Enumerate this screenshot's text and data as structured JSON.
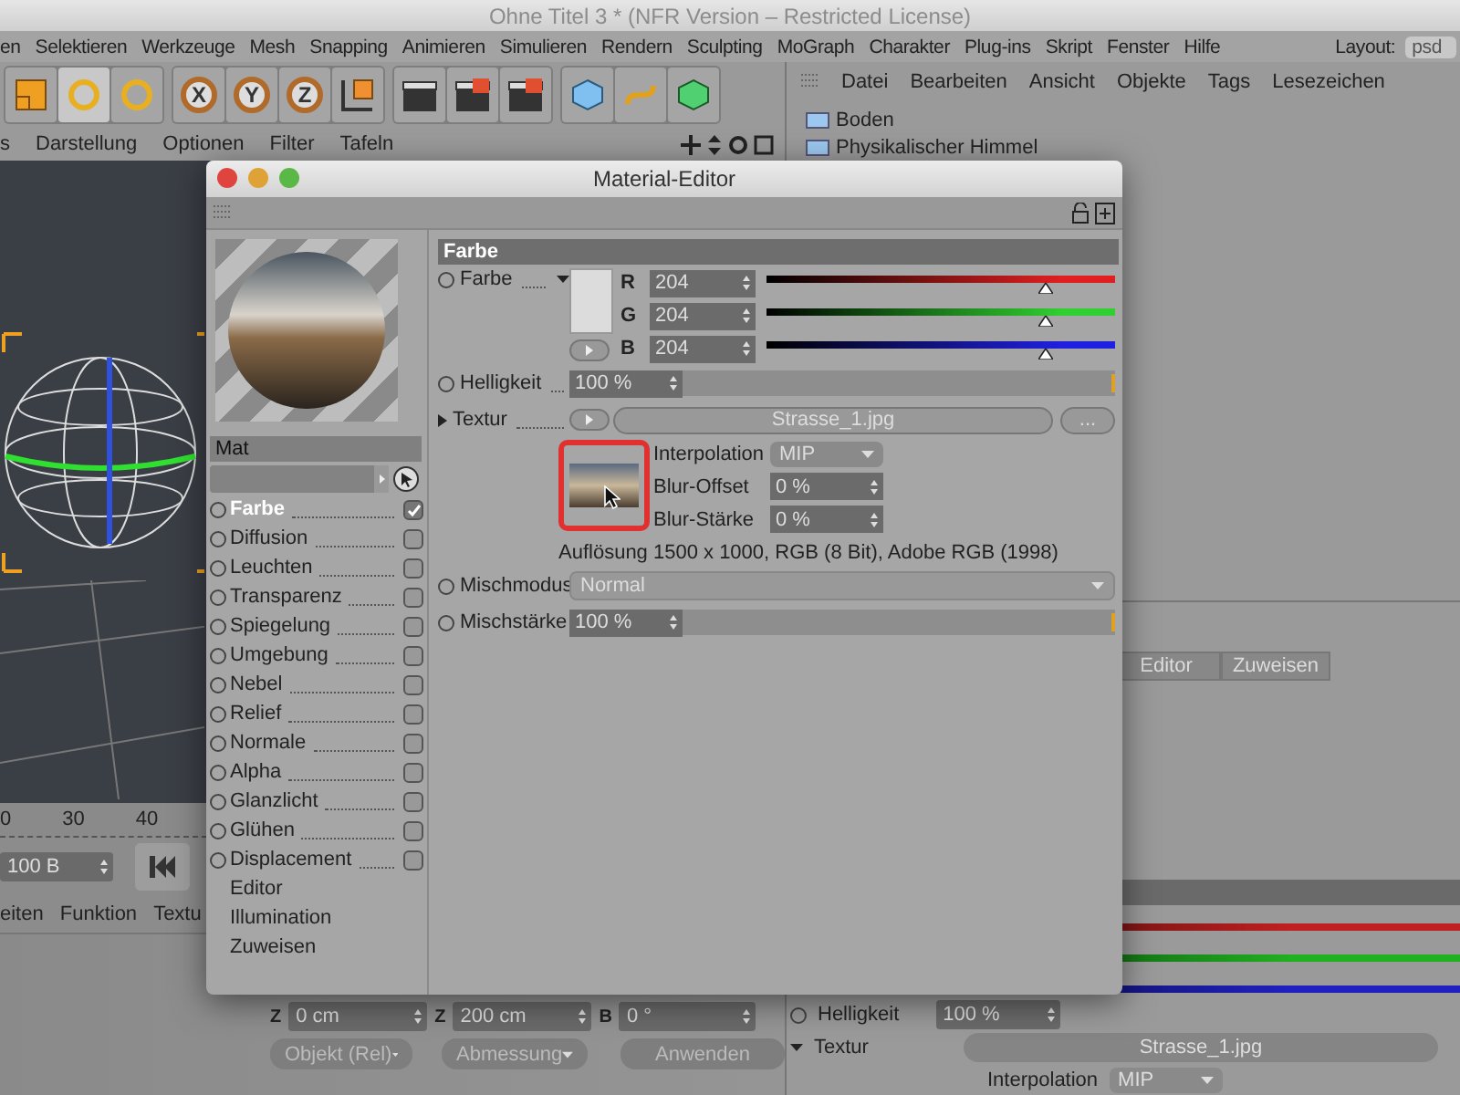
{
  "app": {
    "title": "Ohne Titel 3 * (NFR Version – Restricted License)",
    "menu": [
      "en",
      "Selektieren",
      "Werkzeuge",
      "Mesh",
      "Snapping",
      "Animieren",
      "Simulieren",
      "Rendern",
      "Sculpting",
      "MoGraph",
      "Charakter",
      "Plug-ins",
      "Skript",
      "Fenster",
      "Hilfe"
    ],
    "layout_label": "Layout:",
    "layout_value": "psd"
  },
  "toolbar": {
    "axis_buttons": [
      "X",
      "Y",
      "Z"
    ]
  },
  "viewport": {
    "menu": [
      "s",
      "Darstellung",
      "Optionen",
      "Filter",
      "Tafeln"
    ],
    "ruler": [
      "0",
      "30",
      "40"
    ],
    "frame_field": "100 B",
    "bottom_menu": [
      "eiten",
      "Funktion",
      "Textu"
    ]
  },
  "coordinates": {
    "fields": [
      {
        "label": "Z",
        "value": "0 cm"
      },
      {
        "label": "Z",
        "value": "200 cm"
      },
      {
        "label": "B",
        "value": "0 °"
      }
    ],
    "dropdowns": [
      "Objekt (Rel)",
      "Abmessung"
    ],
    "apply": "Anwenden"
  },
  "object_manager": {
    "menu": [
      "Datei",
      "Bearbeiten",
      "Ansicht",
      "Objekte",
      "Tags",
      "Lesezeichen"
    ],
    "objects": [
      "Boden",
      "Physikalischer Himmel"
    ]
  },
  "attribute_manager": {
    "tabs": [
      {
        "label": "Editor",
        "selected": false
      },
      {
        "label": "Zuweisen",
        "selected": false
      }
    ],
    "sliders": [
      {
        "color": "#c02020"
      },
      {
        "color": "#20b020"
      },
      {
        "color": "#2020c0"
      }
    ],
    "brightness": {
      "label": "Helligkeit",
      "value": "100 %"
    },
    "texture": {
      "label": "Textur",
      "file": "Strasse_1.jpg"
    },
    "interpolation": {
      "label": "Interpolation",
      "value": "MIP"
    }
  },
  "material_editor": {
    "title": "Material-Editor",
    "name": "Mat",
    "channels": [
      {
        "label": "Farbe",
        "checked": true,
        "selected": true
      },
      {
        "label": "Diffusion",
        "checked": false,
        "selected": false
      },
      {
        "label": "Leuchten",
        "checked": false,
        "selected": false
      },
      {
        "label": "Transparenz",
        "checked": false,
        "selected": false
      },
      {
        "label": "Spiegelung",
        "checked": false,
        "selected": false
      },
      {
        "label": "Umgebung",
        "checked": false,
        "selected": false
      },
      {
        "label": "Nebel",
        "checked": false,
        "selected": false
      },
      {
        "label": "Relief",
        "checked": false,
        "selected": false
      },
      {
        "label": "Normale",
        "checked": false,
        "selected": false
      },
      {
        "label": "Alpha",
        "checked": false,
        "selected": false
      },
      {
        "label": "Glanzlicht",
        "checked": false,
        "selected": false
      },
      {
        "label": "Glühen",
        "checked": false,
        "selected": false
      },
      {
        "label": "Displacement",
        "checked": false,
        "selected": false
      }
    ],
    "extras": [
      "Editor",
      "Illumination",
      "Zuweisen"
    ],
    "section": "Farbe",
    "color": {
      "label": "Farbe",
      "channels": [
        {
          "label": "R",
          "value": "204",
          "level": 0.8,
          "color": "#e02020"
        },
        {
          "label": "G",
          "value": "204",
          "level": 0.8,
          "color": "#30d030"
        },
        {
          "label": "B",
          "value": "204",
          "level": 0.8,
          "color": "#2020e0"
        }
      ]
    },
    "brightness": {
      "label": "Helligkeit",
      "value": "100 %",
      "level": 1
    },
    "texture": {
      "label": "Textur",
      "file": "Strasse_1.jpg",
      "browse": "...",
      "params": [
        {
          "label": "Interpolation",
          "value": "MIP",
          "kind": "dropdown"
        },
        {
          "label": "Blur-Offset",
          "value": "0 %",
          "kind": "spinner"
        },
        {
          "label": "Blur-Stärke",
          "value": "0 %",
          "kind": "spinner"
        }
      ],
      "info": "Auflösung 1500 x 1000, RGB (8 Bit), Adobe RGB (1998)"
    },
    "mix_mode": {
      "label": "Mischmodus",
      "value": "Normal"
    },
    "mix_strength": {
      "label": "Mischstärke",
      "value": "100 %",
      "level": 1
    }
  }
}
